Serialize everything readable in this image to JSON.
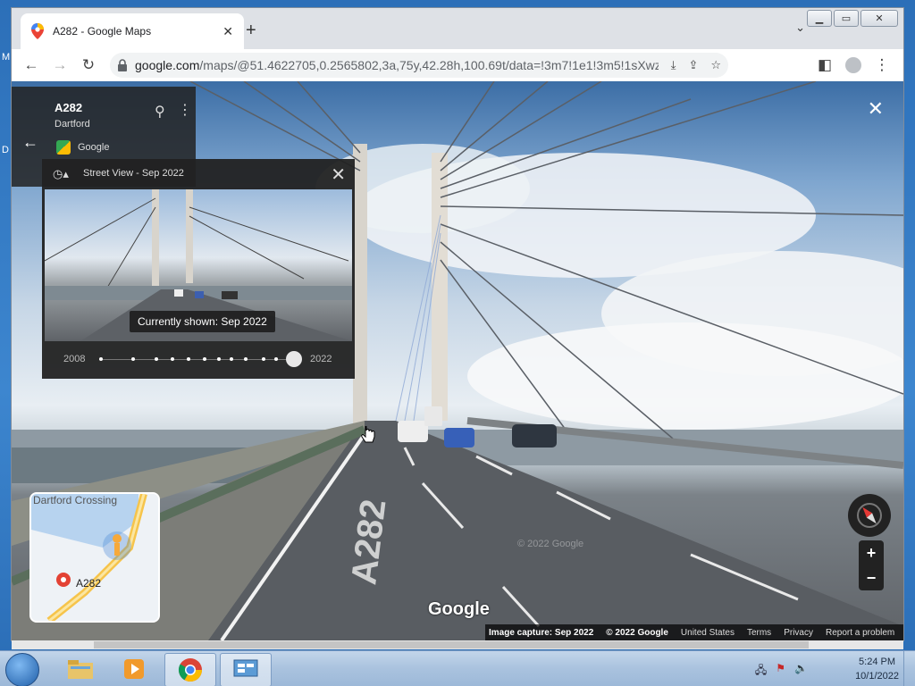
{
  "desktop": {
    "left_labels": [
      "M",
      "D"
    ]
  },
  "browser": {
    "tab": {
      "title": "A282 - Google Maps"
    },
    "url": {
      "host": "google.com",
      "path": "/maps/@51.4622705,0.2565802,3a,75y,42.28h,100.69t/data=!3m7!1e1!3m5!1sXwzCahVz9u..."
    }
  },
  "streetview": {
    "place": {
      "title": "A282",
      "subtitle": "Dartford",
      "provider": "Google"
    },
    "time_machine": {
      "title": "Street View - Sep 2022",
      "tooltip": "Currently shown: Sep 2022",
      "year_start": "2008",
      "year_end": "2022",
      "selected_fraction": 1.0
    },
    "minimap": {
      "title": "Dartford Crossing",
      "label": "A282"
    },
    "watermark": "Google",
    "faint_watermark": "© 2022 Google",
    "footer": {
      "capture": "Image capture: Sep 2022",
      "copyright": "© 2022 Google",
      "region": "United States",
      "terms": "Terms",
      "privacy": "Privacy",
      "report": "Report a problem"
    },
    "road_marking": "A282"
  },
  "taskbar": {
    "time": "5:24 PM",
    "date": "10/1/2022"
  }
}
